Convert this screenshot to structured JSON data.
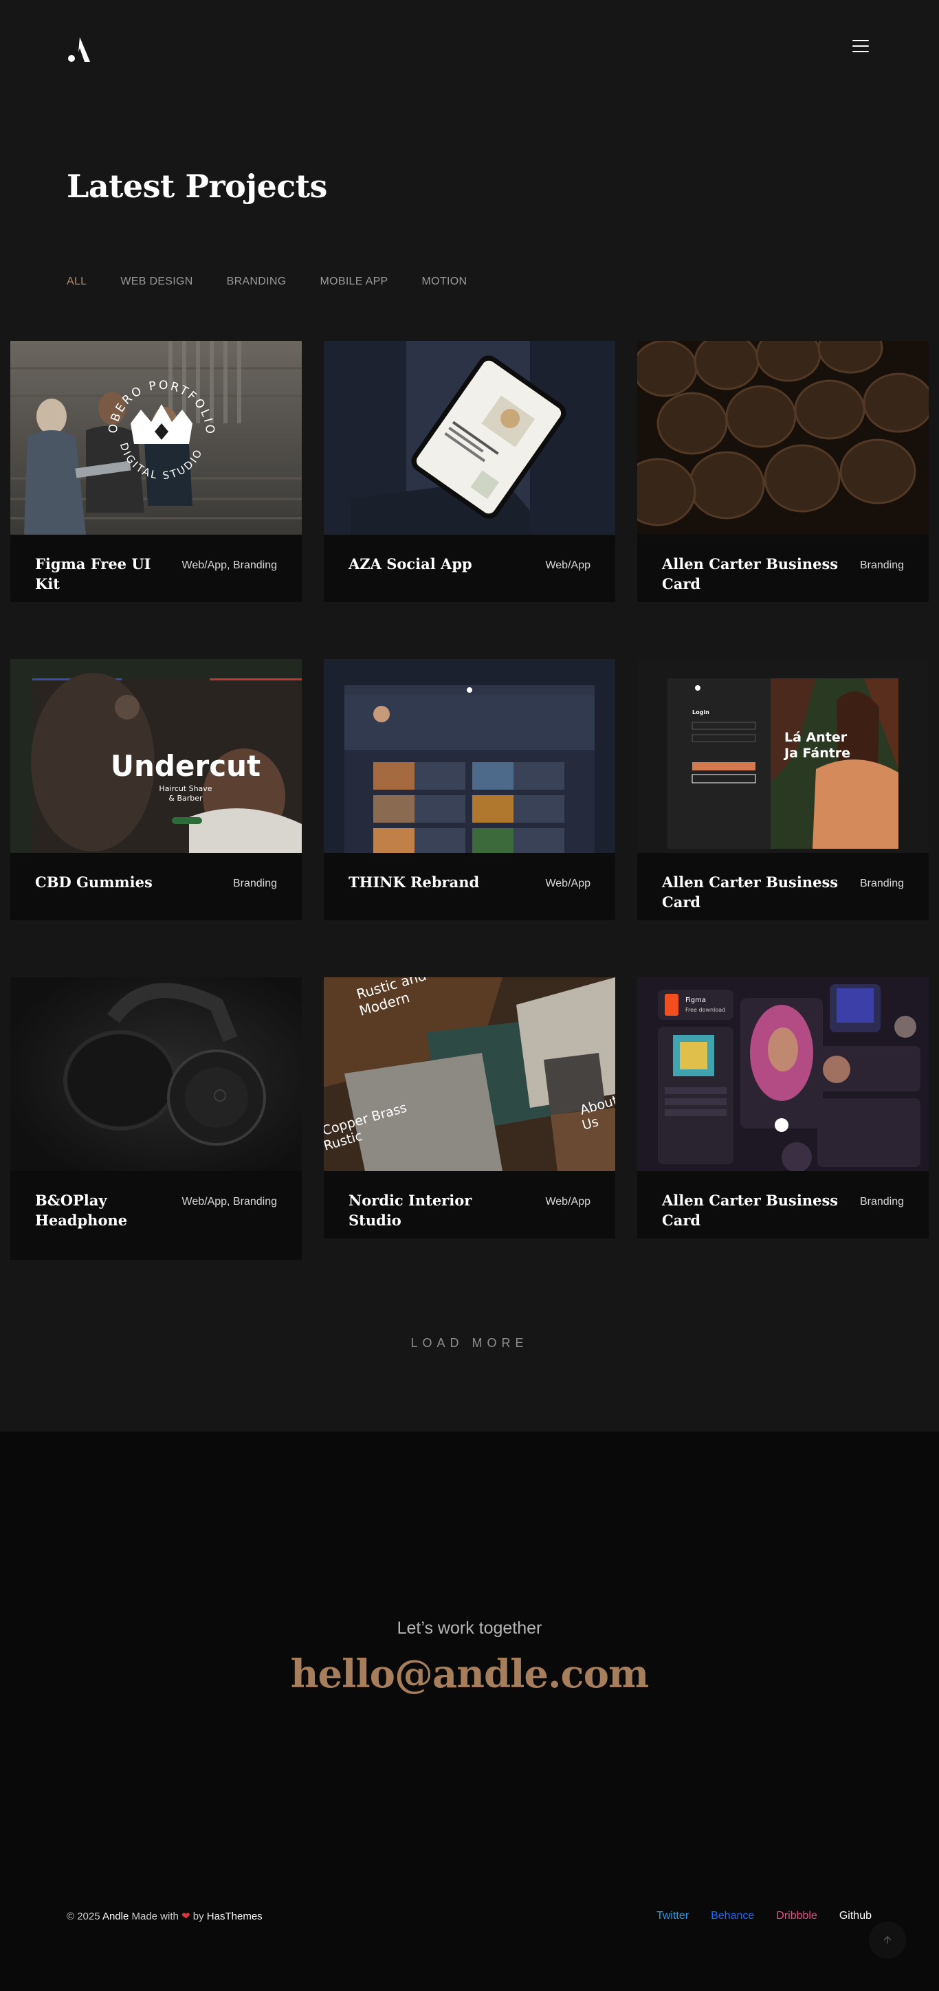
{
  "header": {
    "logo_alt": "Andle logo",
    "menu_icon": "hamburger-menu-icon"
  },
  "main": {
    "title": "Latest Projects",
    "filters": [
      "ALL",
      "WEB DESIGN",
      "BRANDING",
      "MOBILE APP",
      "MOTION"
    ],
    "active_filter": "ALL",
    "load_more": "LOAD MORE"
  },
  "projects": [
    {
      "title": "Figma Free UI Kit",
      "category": "Web/App, Branding",
      "badge_text": "OBERO PORTFOLIO · DIGITAL STUDIO"
    },
    {
      "title": "AZA Social App",
      "category": "Web/App"
    },
    {
      "title": "Allen Carter Business Card",
      "category": "Branding"
    },
    {
      "title": "CBD Gummies",
      "category": "Branding",
      "thumb_heading": "Undercut",
      "thumb_sub1": "Haircut Shave",
      "thumb_sub2": "& Barber"
    },
    {
      "title": "THINK Rebrand",
      "category": "Web/App"
    },
    {
      "title": "Allen Carter Business Card",
      "category": "Branding",
      "thumb_heading1": "Lá Anter",
      "thumb_heading2": "Ja Fántre",
      "thumb_login": "Login"
    },
    {
      "title": "B&OPlay Headphone",
      "category": "Web/App, Branding"
    },
    {
      "title": "Nordic Interior Studio",
      "category": "Web/App",
      "thumb_text1": "Rustic and",
      "thumb_text2": "Modern",
      "thumb_text3": "Copper Brass",
      "thumb_text4": "Rustic",
      "thumb_text5": "About",
      "thumb_text6": "Us"
    },
    {
      "title": "Allen Carter Business Card",
      "category": "Branding",
      "thumb_text1": "Figma",
      "thumb_text2": "Free download"
    }
  ],
  "footer": {
    "tagline": "Let’s work together",
    "email": "hello@andle.com",
    "copyright_prefix": "© 2025",
    "brand": "Andle",
    "made_with": "Made with",
    "by": "by",
    "company": "HasThemes",
    "social": [
      {
        "label": "Twitter",
        "color": "#1da1f2"
      },
      {
        "label": "Behance",
        "color": "#1769ff"
      },
      {
        "label": "Dribbble",
        "color": "#ea4c89"
      },
      {
        "label": "Github",
        "color": "#ffffff"
      }
    ]
  },
  "colors": {
    "accent": "#b38b6b",
    "email": "#a77e5c",
    "background": "#161616",
    "card": "#0c0c0c",
    "footer": "#090909"
  }
}
